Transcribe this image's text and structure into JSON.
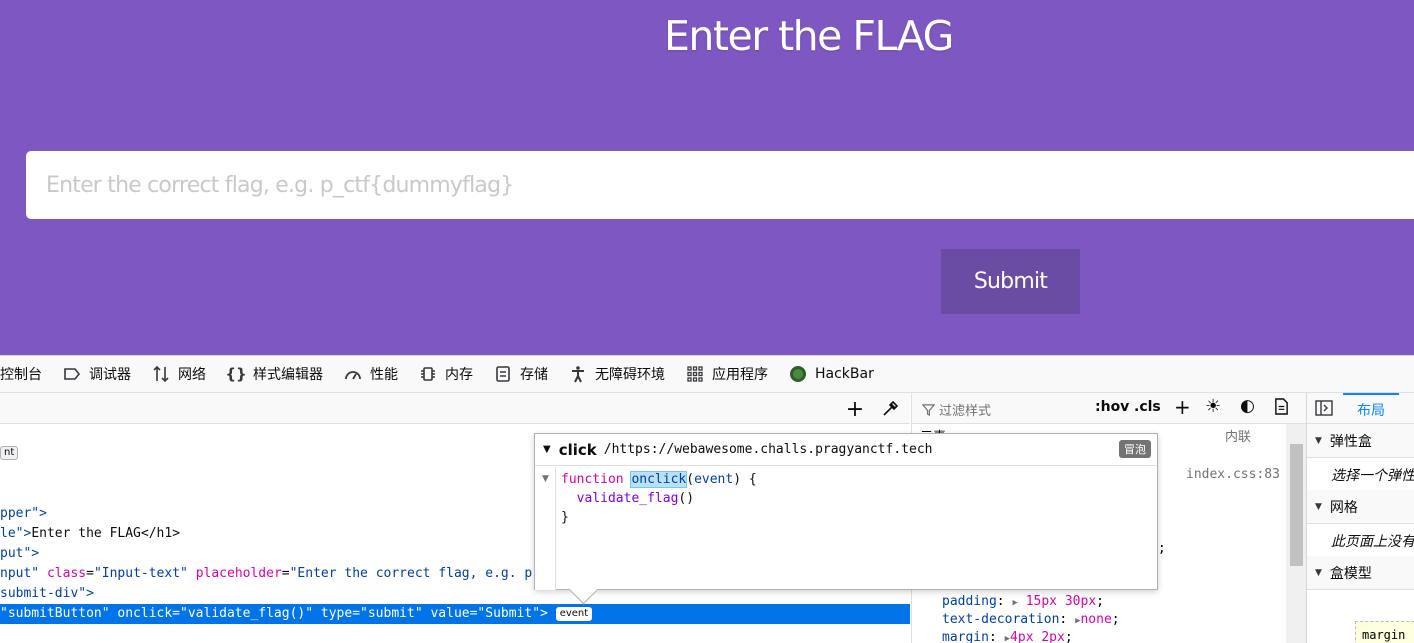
{
  "page": {
    "title": "Enter the FLAG",
    "input_placeholder": "Enter the correct flag, e.g. p_ctf{dummyflag}",
    "submit_label": "Submit",
    "bg_color": "#7e57c2",
    "button_color": "#6a4ca5"
  },
  "devtools": {
    "tabs": [
      {
        "label": "控制台",
        "icon": "console-icon"
      },
      {
        "label": "调试器",
        "icon": "debugger-icon"
      },
      {
        "label": "网络",
        "icon": "network-icon"
      },
      {
        "label": "样式编辑器",
        "icon": "style-editor-icon"
      },
      {
        "label": "性能",
        "icon": "performance-icon"
      },
      {
        "label": "内存",
        "icon": "memory-icon"
      },
      {
        "label": "存储",
        "icon": "storage-icon"
      },
      {
        "label": "无障碍环境",
        "icon": "accessibility-icon"
      },
      {
        "label": "应用程序",
        "icon": "application-icon"
      },
      {
        "label": "HackBar",
        "icon": "hackbar-icon"
      }
    ],
    "markup": {
      "badge_top": "nt",
      "line1_head": "pper\">",
      "line2_head": "le\">",
      "line2_text": "Enter the FLAG",
      "line2_close": "</h1>",
      "line3_head": "put\">",
      "line4_head": "nput\"",
      "line4_attr1": "class",
      "line4_val1": "\"Input-text\"",
      "line4_attr2": "placeholder",
      "line4_val2": "\"Enter the correct flag, e.g. p",
      "line5_head": "submit-div\">",
      "selected_line": "\"submitButton\" onclick=\"validate_flag()\" type=\"submit\" value=\"Submit\">",
      "event_badge": "event"
    },
    "rules": {
      "filter_placeholder": "过滤样式",
      "hov": ":hov",
      "cls": ".cls",
      "element_label": "元素",
      "inline_label": "内联",
      "source": "index.css:83",
      "partial_semicolon": "t;",
      "props": [
        {
          "name": "padding",
          "value": "15px 30px"
        },
        {
          "name": "text-decoration",
          "value": "none"
        },
        {
          "name": "margin",
          "value": "4px 2px"
        }
      ]
    },
    "layout": {
      "tab_label": "布局",
      "sections": [
        {
          "title": "弹性盒",
          "note": "选择一个弹性"
        },
        {
          "title": "网格",
          "note": "此页面上没有"
        },
        {
          "title": "盒模型",
          "note": ""
        }
      ],
      "margin_label": "margin"
    },
    "tooltip": {
      "event": "click",
      "origin": "/https://webawesome.challs.pragyanctf.tech",
      "bubble": "冒泡",
      "kw_function": "function",
      "fn_name": "onclick",
      "fn_arg": "event",
      "call": "validate_flag",
      "close": "}"
    }
  }
}
